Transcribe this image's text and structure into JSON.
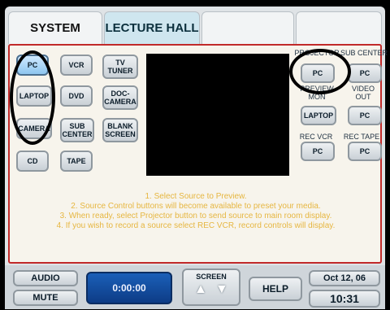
{
  "tabs": {
    "system": "SYSTEM",
    "lecture": "LECTURE HALL",
    "tab3": "",
    "tab4": ""
  },
  "sources": {
    "pc": "PC",
    "vcr": "VCR",
    "tv_tuner": "TV TUNER",
    "laptop": "LAPTOP",
    "dvd": "DVD",
    "doc_camera": "DOC-CAMERA",
    "camera": "CAMERA",
    "sub_center": "SUB CENTER",
    "blank_screen": "BLANK SCREEN",
    "cd": "CD",
    "tape": "TAPE"
  },
  "outputs": {
    "projector_label": "PROJECTOR",
    "projector_value": "PC",
    "sub_center_label": "SUB CENTER",
    "sub_center_value": "PC",
    "preview_label": "PREVIEW MON",
    "preview_value": "LAPTOP",
    "video_out_label": "VIDEO OUT",
    "video_out_value": "PC",
    "rec_vcr_label": "REC VCR",
    "rec_vcr_value": "PC",
    "rec_tape_label": "REC TAPE",
    "rec_tape_value": "PC"
  },
  "instructions": [
    "1. Select Source to Preview.",
    "2. Source Control buttons will become available to preset your media.",
    "3. When ready, select Projector button to send source to main room display.",
    "4. If you wish to record a source select REC VCR, record controls will display."
  ],
  "bottom": {
    "audio": "AUDIO",
    "mute": "MUTE",
    "timer": "0:00:00",
    "screen": "SCREEN",
    "help": "HELP",
    "date": "Oct 12, 06",
    "time": "10:31"
  },
  "colors": {
    "accent": "#c12a2a",
    "instructions": "#e6b640",
    "timer_bg": "#1b5fb8"
  }
}
